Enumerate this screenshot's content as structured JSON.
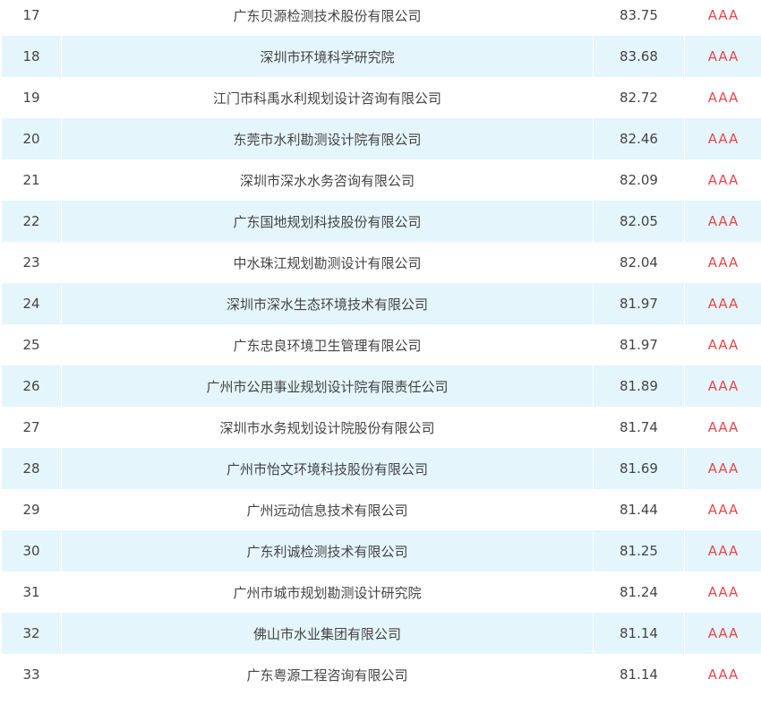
{
  "table": {
    "rows": [
      {
        "rank": "17",
        "name": "广东贝源检测技术股份有限公司",
        "score": "83.75",
        "grade": "AAA"
      },
      {
        "rank": "18",
        "name": "深圳市环境科学研究院",
        "score": "83.68",
        "grade": "AAA"
      },
      {
        "rank": "19",
        "name": "江门市科禹水利规划设计咨询有限公司",
        "score": "82.72",
        "grade": "AAA"
      },
      {
        "rank": "20",
        "name": "东莞市水利勘测设计院有限公司",
        "score": "82.46",
        "grade": "AAA"
      },
      {
        "rank": "21",
        "name": "深圳市深水水务咨询有限公司",
        "score": "82.09",
        "grade": "AAA"
      },
      {
        "rank": "22",
        "name": "广东国地规划科技股份有限公司",
        "score": "82.05",
        "grade": "AAA"
      },
      {
        "rank": "23",
        "name": "中水珠江规划勘测设计有限公司",
        "score": "82.04",
        "grade": "AAA"
      },
      {
        "rank": "24",
        "name": "深圳市深水生态环境技术有限公司",
        "score": "81.97",
        "grade": "AAA"
      },
      {
        "rank": "25",
        "name": "广东忠良环境卫生管理有限公司",
        "score": "81.97",
        "grade": "AAA"
      },
      {
        "rank": "26",
        "name": "广州市公用事业规划设计院有限责任公司",
        "score": "81.89",
        "grade": "AAA"
      },
      {
        "rank": "27",
        "name": "深圳市水务规划设计院股份有限公司",
        "score": "81.74",
        "grade": "AAA"
      },
      {
        "rank": "28",
        "name": "广州市怡文环境科技股份有限公司",
        "score": "81.69",
        "grade": "AAA"
      },
      {
        "rank": "29",
        "name": "广州远动信息技术有限公司",
        "score": "81.44",
        "grade": "AAA"
      },
      {
        "rank": "30",
        "name": "广东利诚检测技术有限公司",
        "score": "81.25",
        "grade": "AAA"
      },
      {
        "rank": "31",
        "name": "广州市城市规划勘测设计研究院",
        "score": "81.24",
        "grade": "AAA"
      },
      {
        "rank": "32",
        "name": "佛山市水业集团有限公司",
        "score": "81.14",
        "grade": "AAA"
      },
      {
        "rank": "33",
        "name": "广东粤源工程咨询有限公司",
        "score": "81.14",
        "grade": "AAA"
      }
    ]
  }
}
